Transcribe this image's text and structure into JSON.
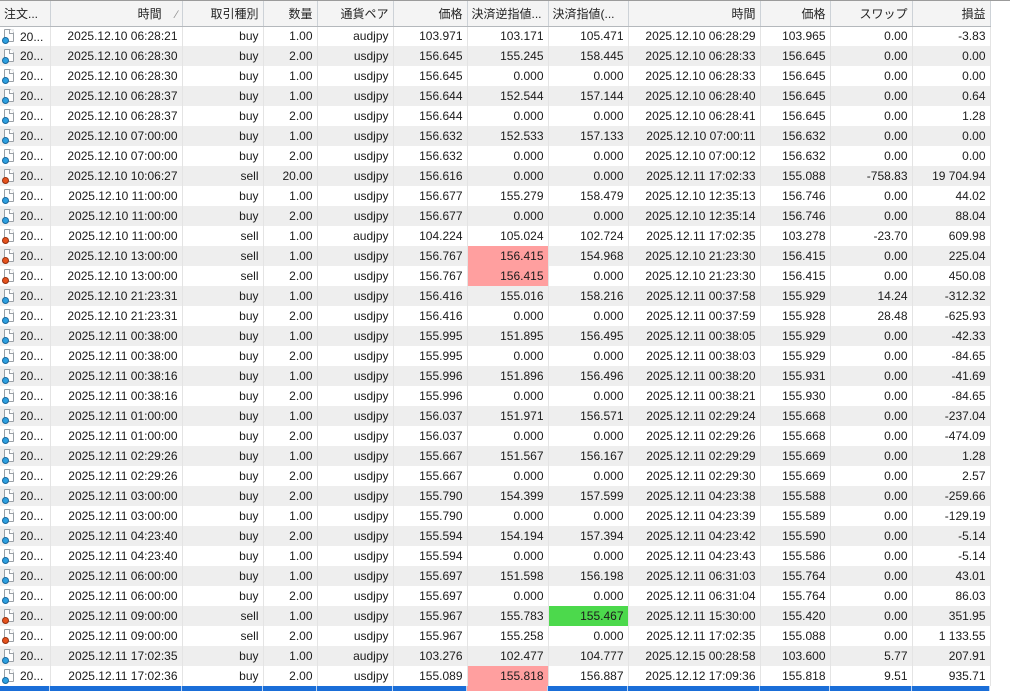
{
  "table": {
    "sort_indicator": "∕",
    "columns": [
      {
        "label": "注文..."
      },
      {
        "label": "時間"
      },
      {
        "label": "取引種別"
      },
      {
        "label": "数量"
      },
      {
        "label": "通貨ペア"
      },
      {
        "label": "価格"
      },
      {
        "label": "決済逆指値..."
      },
      {
        "label": "決済指値(..."
      },
      {
        "label": "時間"
      },
      {
        "label": "価格"
      },
      {
        "label": "スワップ"
      },
      {
        "label": "損益"
      }
    ],
    "rows": [
      {
        "order": "20...",
        "open_time": "2025.12.10 06:28:21",
        "type": "buy",
        "volume": "1.00",
        "symbol": "audjpy",
        "open_price": "103.971",
        "sl": "103.171",
        "tp": "105.471",
        "close_time": "2025.12.10 06:28:29",
        "close_price": "103.965",
        "swap": "0.00",
        "profit": "-3.83",
        "sl_hl": false,
        "tp_hl": false
      },
      {
        "order": "20...",
        "open_time": "2025.12.10 06:28:30",
        "type": "buy",
        "volume": "2.00",
        "symbol": "usdjpy",
        "open_price": "156.645",
        "sl": "155.245",
        "tp": "158.445",
        "close_time": "2025.12.10 06:28:33",
        "close_price": "156.645",
        "swap": "0.00",
        "profit": "0.00",
        "sl_hl": false,
        "tp_hl": false
      },
      {
        "order": "20...",
        "open_time": "2025.12.10 06:28:30",
        "type": "buy",
        "volume": "1.00",
        "symbol": "usdjpy",
        "open_price": "156.645",
        "sl": "0.000",
        "tp": "0.000",
        "close_time": "2025.12.10 06:28:33",
        "close_price": "156.645",
        "swap": "0.00",
        "profit": "0.00",
        "sl_hl": false,
        "tp_hl": false
      },
      {
        "order": "20...",
        "open_time": "2025.12.10 06:28:37",
        "type": "buy",
        "volume": "1.00",
        "symbol": "usdjpy",
        "open_price": "156.644",
        "sl": "152.544",
        "tp": "157.144",
        "close_time": "2025.12.10 06:28:40",
        "close_price": "156.645",
        "swap": "0.00",
        "profit": "0.64",
        "sl_hl": false,
        "tp_hl": false
      },
      {
        "order": "20...",
        "open_time": "2025.12.10 06:28:37",
        "type": "buy",
        "volume": "2.00",
        "symbol": "usdjpy",
        "open_price": "156.644",
        "sl": "0.000",
        "tp": "0.000",
        "close_time": "2025.12.10 06:28:41",
        "close_price": "156.645",
        "swap": "0.00",
        "profit": "1.28",
        "sl_hl": false,
        "tp_hl": false
      },
      {
        "order": "20...",
        "open_time": "2025.12.10 07:00:00",
        "type": "buy",
        "volume": "1.00",
        "symbol": "usdjpy",
        "open_price": "156.632",
        "sl": "152.533",
        "tp": "157.133",
        "close_time": "2025.12.10 07:00:11",
        "close_price": "156.632",
        "swap": "0.00",
        "profit": "0.00",
        "sl_hl": false,
        "tp_hl": false
      },
      {
        "order": "20...",
        "open_time": "2025.12.10 07:00:00",
        "type": "buy",
        "volume": "2.00",
        "symbol": "usdjpy",
        "open_price": "156.632",
        "sl": "0.000",
        "tp": "0.000",
        "close_time": "2025.12.10 07:00:12",
        "close_price": "156.632",
        "swap": "0.00",
        "profit": "0.00",
        "sl_hl": false,
        "tp_hl": false
      },
      {
        "order": "20...",
        "open_time": "2025.12.10 10:06:27",
        "type": "sell",
        "volume": "20.00",
        "symbol": "usdjpy",
        "open_price": "156.616",
        "sl": "0.000",
        "tp": "0.000",
        "close_time": "2025.12.11 17:02:33",
        "close_price": "155.088",
        "swap": "-758.83",
        "profit": "19 704.94",
        "sl_hl": false,
        "tp_hl": false
      },
      {
        "order": "20...",
        "open_time": "2025.12.10 11:00:00",
        "type": "buy",
        "volume": "1.00",
        "symbol": "usdjpy",
        "open_price": "156.677",
        "sl": "155.279",
        "tp": "158.479",
        "close_time": "2025.12.10 12:35:13",
        "close_price": "156.746",
        "swap": "0.00",
        "profit": "44.02",
        "sl_hl": false,
        "tp_hl": false
      },
      {
        "order": "20...",
        "open_time": "2025.12.10 11:00:00",
        "type": "buy",
        "volume": "2.00",
        "symbol": "usdjpy",
        "open_price": "156.677",
        "sl": "0.000",
        "tp": "0.000",
        "close_time": "2025.12.10 12:35:14",
        "close_price": "156.746",
        "swap": "0.00",
        "profit": "88.04",
        "sl_hl": false,
        "tp_hl": false
      },
      {
        "order": "20...",
        "open_time": "2025.12.10 11:00:00",
        "type": "sell",
        "volume": "1.00",
        "symbol": "audjpy",
        "open_price": "104.224",
        "sl": "105.024",
        "tp": "102.724",
        "close_time": "2025.12.11 17:02:35",
        "close_price": "103.278",
        "swap": "-23.70",
        "profit": "609.98",
        "sl_hl": false,
        "tp_hl": false
      },
      {
        "order": "20...",
        "open_time": "2025.12.10 13:00:00",
        "type": "sell",
        "volume": "1.00",
        "symbol": "usdjpy",
        "open_price": "156.767",
        "sl": "156.415",
        "tp": "154.968",
        "close_time": "2025.12.10 21:23:30",
        "close_price": "156.415",
        "swap": "0.00",
        "profit": "225.04",
        "sl_hl": true,
        "tp_hl": false
      },
      {
        "order": "20...",
        "open_time": "2025.12.10 13:00:00",
        "type": "sell",
        "volume": "2.00",
        "symbol": "usdjpy",
        "open_price": "156.767",
        "sl": "156.415",
        "tp": "0.000",
        "close_time": "2025.12.10 21:23:30",
        "close_price": "156.415",
        "swap": "0.00",
        "profit": "450.08",
        "sl_hl": true,
        "tp_hl": false
      },
      {
        "order": "20...",
        "open_time": "2025.12.10 21:23:31",
        "type": "buy",
        "volume": "1.00",
        "symbol": "usdjpy",
        "open_price": "156.416",
        "sl": "155.016",
        "tp": "158.216",
        "close_time": "2025.12.11 00:37:58",
        "close_price": "155.929",
        "swap": "14.24",
        "profit": "-312.32",
        "sl_hl": false,
        "tp_hl": false
      },
      {
        "order": "20...",
        "open_time": "2025.12.10 21:23:31",
        "type": "buy",
        "volume": "2.00",
        "symbol": "usdjpy",
        "open_price": "156.416",
        "sl": "0.000",
        "tp": "0.000",
        "close_time": "2025.12.11 00:37:59",
        "close_price": "155.928",
        "swap": "28.48",
        "profit": "-625.93",
        "sl_hl": false,
        "tp_hl": false
      },
      {
        "order": "20...",
        "open_time": "2025.12.11 00:38:00",
        "type": "buy",
        "volume": "1.00",
        "symbol": "usdjpy",
        "open_price": "155.995",
        "sl": "151.895",
        "tp": "156.495",
        "close_time": "2025.12.11 00:38:05",
        "close_price": "155.929",
        "swap": "0.00",
        "profit": "-42.33",
        "sl_hl": false,
        "tp_hl": false
      },
      {
        "order": "20...",
        "open_time": "2025.12.11 00:38:00",
        "type": "buy",
        "volume": "2.00",
        "symbol": "usdjpy",
        "open_price": "155.995",
        "sl": "0.000",
        "tp": "0.000",
        "close_time": "2025.12.11 00:38:03",
        "close_price": "155.929",
        "swap": "0.00",
        "profit": "-84.65",
        "sl_hl": false,
        "tp_hl": false
      },
      {
        "order": "20...",
        "open_time": "2025.12.11 00:38:16",
        "type": "buy",
        "volume": "1.00",
        "symbol": "usdjpy",
        "open_price": "155.996",
        "sl": "151.896",
        "tp": "156.496",
        "close_time": "2025.12.11 00:38:20",
        "close_price": "155.931",
        "swap": "0.00",
        "profit": "-41.69",
        "sl_hl": false,
        "tp_hl": false
      },
      {
        "order": "20...",
        "open_time": "2025.12.11 00:38:16",
        "type": "buy",
        "volume": "2.00",
        "symbol": "usdjpy",
        "open_price": "155.996",
        "sl": "0.000",
        "tp": "0.000",
        "close_time": "2025.12.11 00:38:21",
        "close_price": "155.930",
        "swap": "0.00",
        "profit": "-84.65",
        "sl_hl": false,
        "tp_hl": false
      },
      {
        "order": "20...",
        "open_time": "2025.12.11 01:00:00",
        "type": "buy",
        "volume": "1.00",
        "symbol": "usdjpy",
        "open_price": "156.037",
        "sl": "151.971",
        "tp": "156.571",
        "close_time": "2025.12.11 02:29:24",
        "close_price": "155.668",
        "swap": "0.00",
        "profit": "-237.04",
        "sl_hl": false,
        "tp_hl": false
      },
      {
        "order": "20...",
        "open_time": "2025.12.11 01:00:00",
        "type": "buy",
        "volume": "2.00",
        "symbol": "usdjpy",
        "open_price": "156.037",
        "sl": "0.000",
        "tp": "0.000",
        "close_time": "2025.12.11 02:29:26",
        "close_price": "155.668",
        "swap": "0.00",
        "profit": "-474.09",
        "sl_hl": false,
        "tp_hl": false
      },
      {
        "order": "20...",
        "open_time": "2025.12.11 02:29:26",
        "type": "buy",
        "volume": "1.00",
        "symbol": "usdjpy",
        "open_price": "155.667",
        "sl": "151.567",
        "tp": "156.167",
        "close_time": "2025.12.11 02:29:29",
        "close_price": "155.669",
        "swap": "0.00",
        "profit": "1.28",
        "sl_hl": false,
        "tp_hl": false
      },
      {
        "order": "20...",
        "open_time": "2025.12.11 02:29:26",
        "type": "buy",
        "volume": "2.00",
        "symbol": "usdjpy",
        "open_price": "155.667",
        "sl": "0.000",
        "tp": "0.000",
        "close_time": "2025.12.11 02:29:30",
        "close_price": "155.669",
        "swap": "0.00",
        "profit": "2.57",
        "sl_hl": false,
        "tp_hl": false
      },
      {
        "order": "20...",
        "open_time": "2025.12.11 03:00:00",
        "type": "buy",
        "volume": "2.00",
        "symbol": "usdjpy",
        "open_price": "155.790",
        "sl": "154.399",
        "tp": "157.599",
        "close_time": "2025.12.11 04:23:38",
        "close_price": "155.588",
        "swap": "0.00",
        "profit": "-259.66",
        "sl_hl": false,
        "tp_hl": false
      },
      {
        "order": "20...",
        "open_time": "2025.12.11 03:00:00",
        "type": "buy",
        "volume": "1.00",
        "symbol": "usdjpy",
        "open_price": "155.790",
        "sl": "0.000",
        "tp": "0.000",
        "close_time": "2025.12.11 04:23:39",
        "close_price": "155.589",
        "swap": "0.00",
        "profit": "-129.19",
        "sl_hl": false,
        "tp_hl": false
      },
      {
        "order": "20...",
        "open_time": "2025.12.11 04:23:40",
        "type": "buy",
        "volume": "2.00",
        "symbol": "usdjpy",
        "open_price": "155.594",
        "sl": "154.194",
        "tp": "157.394",
        "close_time": "2025.12.11 04:23:42",
        "close_price": "155.590",
        "swap": "0.00",
        "profit": "-5.14",
        "sl_hl": false,
        "tp_hl": false
      },
      {
        "order": "20...",
        "open_time": "2025.12.11 04:23:40",
        "type": "buy",
        "volume": "1.00",
        "symbol": "usdjpy",
        "open_price": "155.594",
        "sl": "0.000",
        "tp": "0.000",
        "close_time": "2025.12.11 04:23:43",
        "close_price": "155.586",
        "swap": "0.00",
        "profit": "-5.14",
        "sl_hl": false,
        "tp_hl": false
      },
      {
        "order": "20...",
        "open_time": "2025.12.11 06:00:00",
        "type": "buy",
        "volume": "1.00",
        "symbol": "usdjpy",
        "open_price": "155.697",
        "sl": "151.598",
        "tp": "156.198",
        "close_time": "2025.12.11 06:31:03",
        "close_price": "155.764",
        "swap": "0.00",
        "profit": "43.01",
        "sl_hl": false,
        "tp_hl": false
      },
      {
        "order": "20...",
        "open_time": "2025.12.11 06:00:00",
        "type": "buy",
        "volume": "2.00",
        "symbol": "usdjpy",
        "open_price": "155.697",
        "sl": "0.000",
        "tp": "0.000",
        "close_time": "2025.12.11 06:31:04",
        "close_price": "155.764",
        "swap": "0.00",
        "profit": "86.03",
        "sl_hl": false,
        "tp_hl": false
      },
      {
        "order": "20...",
        "open_time": "2025.12.11 09:00:00",
        "type": "sell",
        "volume": "1.00",
        "symbol": "usdjpy",
        "open_price": "155.967",
        "sl": "155.783",
        "tp": "155.467",
        "close_time": "2025.12.11 15:30:00",
        "close_price": "155.420",
        "swap": "0.00",
        "profit": "351.95",
        "sl_hl": false,
        "tp_hl": true
      },
      {
        "order": "20...",
        "open_time": "2025.12.11 09:00:00",
        "type": "sell",
        "volume": "2.00",
        "symbol": "usdjpy",
        "open_price": "155.967",
        "sl": "155.258",
        "tp": "0.000",
        "close_time": "2025.12.11 17:02:35",
        "close_price": "155.088",
        "swap": "0.00",
        "profit": "1 133.55",
        "sl_hl": false,
        "tp_hl": false
      },
      {
        "order": "20...",
        "open_time": "2025.12.11 17:02:35",
        "type": "buy",
        "volume": "1.00",
        "symbol": "audjpy",
        "open_price": "103.276",
        "sl": "102.477",
        "tp": "104.777",
        "close_time": "2025.12.15 00:28:58",
        "close_price": "103.600",
        "swap": "5.77",
        "profit": "207.91",
        "sl_hl": false,
        "tp_hl": false
      },
      {
        "order": "20...",
        "open_time": "2025.12.11 17:02:36",
        "type": "buy",
        "volume": "2.00",
        "symbol": "usdjpy",
        "open_price": "155.089",
        "sl": "155.818",
        "tp": "156.887",
        "close_time": "2025.12.12 17:09:36",
        "close_price": "155.818",
        "swap": "9.51",
        "profit": "935.71",
        "sl_hl": true,
        "tp_hl": false
      }
    ],
    "partial_selected_row": {
      "visible": true,
      "sl_cell_pink": true
    }
  },
  "colors": {
    "selection_blue": "#1a6ed8",
    "highlight_pink": "#ff9f9f",
    "highlight_green": "#4cd94c",
    "stripe_gray": "#eeeeee",
    "buy_icon_ball": "#2da0e0",
    "sell_icon_ball": "#e5521d"
  }
}
